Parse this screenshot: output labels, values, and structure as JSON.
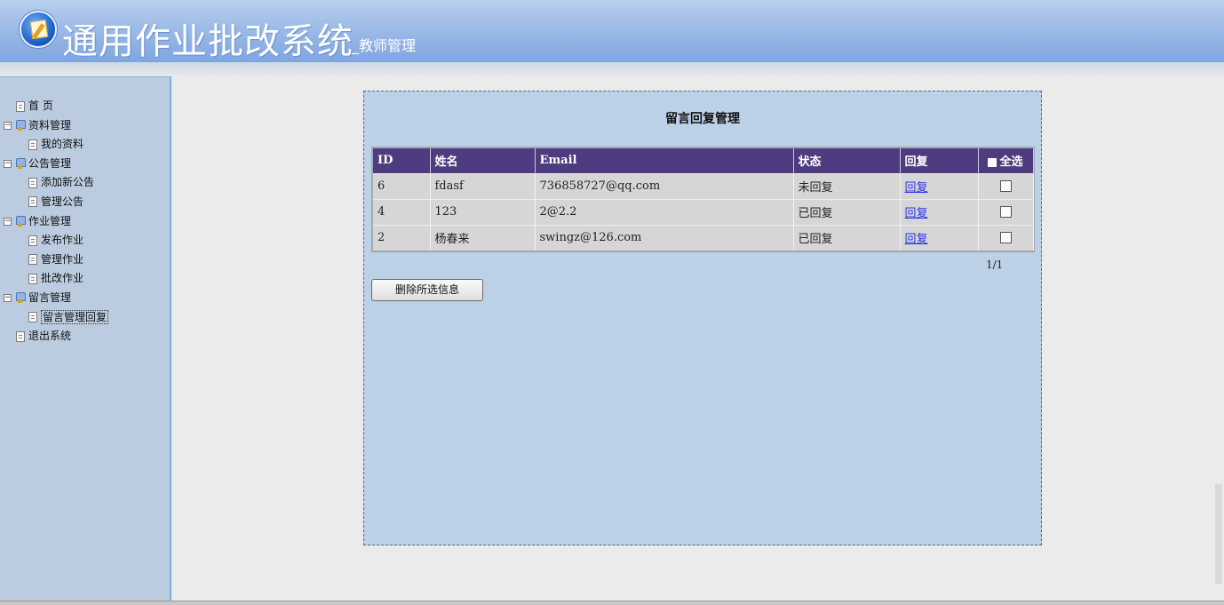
{
  "app": {
    "title": "通用作业批改系统",
    "subtitle": "_教师管理"
  },
  "sidebar": {
    "items": [
      {
        "label": "首 页",
        "type": "page",
        "level": "top"
      },
      {
        "label": "资料管理",
        "type": "folder",
        "level": 0
      },
      {
        "label": "我的资料",
        "type": "page",
        "level": 1
      },
      {
        "label": "公告管理",
        "type": "folder",
        "level": 0
      },
      {
        "label": "添加新公告",
        "type": "page",
        "level": 1
      },
      {
        "label": "管理公告",
        "type": "page",
        "level": 1
      },
      {
        "label": "作业管理",
        "type": "folder",
        "level": 0
      },
      {
        "label": "发布作业",
        "type": "page",
        "level": 1
      },
      {
        "label": "管理作业",
        "type": "page",
        "level": 1
      },
      {
        "label": "批改作业",
        "type": "page",
        "level": 1
      },
      {
        "label": "留言管理",
        "type": "folder",
        "level": 0
      },
      {
        "label": "留言管理回复",
        "type": "page",
        "level": 1,
        "selected": true
      },
      {
        "label": "退出系统",
        "type": "page",
        "level": "top"
      }
    ],
    "expander_symbol": "⊟"
  },
  "main": {
    "title": "留言回复管理",
    "columns": {
      "id": "ID",
      "name": "姓名",
      "email": "Email",
      "status": "状态",
      "reply": "回复",
      "select_all": "全选"
    },
    "rows": [
      {
        "id": "6",
        "name": "fdasf",
        "email": "736858727@qq.com",
        "status": "未回复",
        "reply": "回复"
      },
      {
        "id": "4",
        "name": "123",
        "email": "2@2.2",
        "status": "已回复",
        "reply": "回复"
      },
      {
        "id": "2",
        "name": "杨春来",
        "email": "swingz@126.com",
        "status": "已回复",
        "reply": "回复"
      }
    ],
    "pager": "1/1",
    "delete_button": "删除所选信息"
  }
}
